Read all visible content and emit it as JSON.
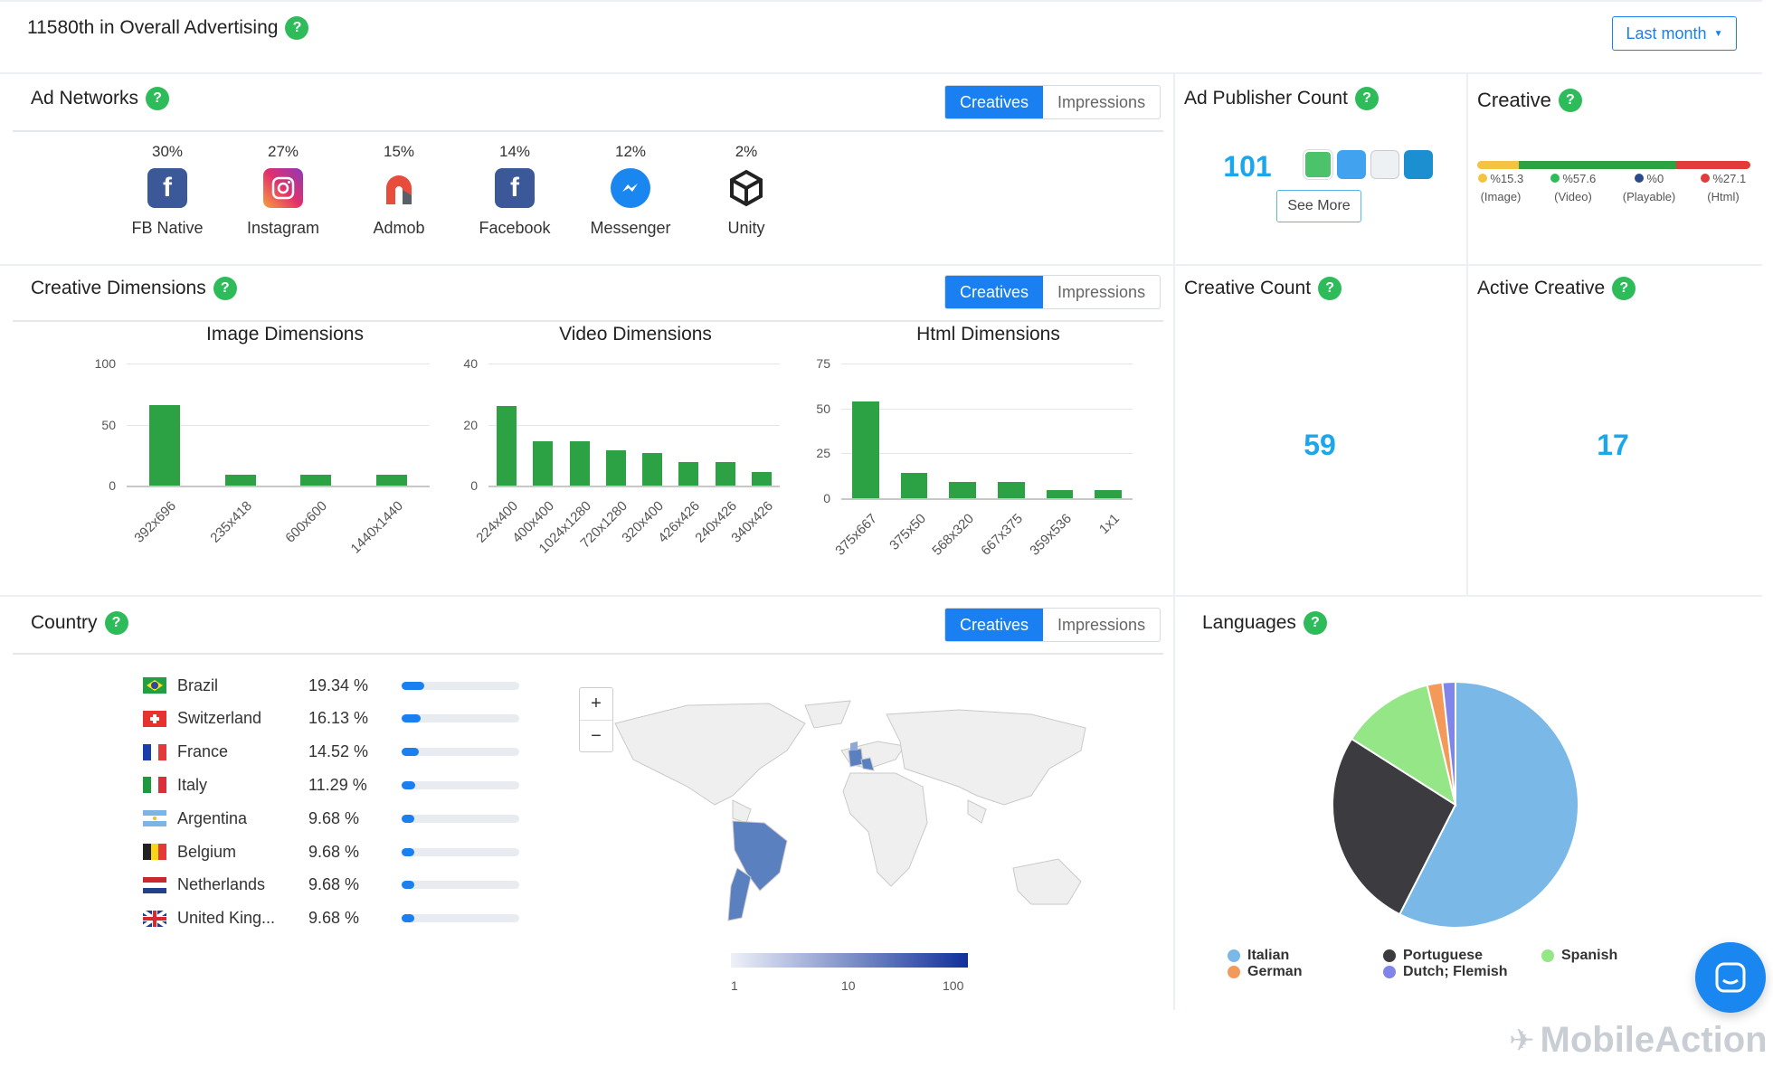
{
  "header": {
    "rank_title": "11580th in Overall Advertising",
    "period_button": "Last month",
    "help": "?"
  },
  "toggle": {
    "creatives": "Creatives",
    "impressions": "Impressions"
  },
  "ad_networks": {
    "title": "Ad Networks",
    "items": [
      {
        "name": "FB Native",
        "pct": "30%",
        "icon": "facebook-icon",
        "color": "#3b5998"
      },
      {
        "name": "Instagram",
        "pct": "27%",
        "icon": "instagram-icon",
        "color": "#e1306c"
      },
      {
        "name": "Admob",
        "pct": "15%",
        "icon": "admob-icon",
        "color": "#e84c3d"
      },
      {
        "name": "Facebook",
        "pct": "14%",
        "icon": "facebook-icon",
        "color": "#3b5998"
      },
      {
        "name": "Messenger",
        "pct": "12%",
        "icon": "messenger-icon",
        "color": "#1a86f0"
      },
      {
        "name": "Unity",
        "pct": "2%",
        "icon": "unity-icon",
        "color": "#222222"
      }
    ]
  },
  "ad_publisher": {
    "title": "Ad Publisher Count",
    "value": "101",
    "see_more": "See More"
  },
  "creative": {
    "title": "Creative",
    "segments": [
      {
        "pct": "%15.3",
        "label": "(Image)",
        "value": 15.3,
        "color": "#f5c342"
      },
      {
        "pct": "%57.6",
        "label": "(Video)",
        "value": 57.6,
        "color": "#2ca244"
      },
      {
        "pct": "%0",
        "label": "(Playable)",
        "value": 0,
        "color": "#2b4a8a"
      },
      {
        "pct": "%27.1",
        "label": "(Html)",
        "value": 27.1,
        "color": "#e03c3c"
      }
    ]
  },
  "creative_dimensions": {
    "title": "Creative Dimensions"
  },
  "creative_count": {
    "title": "Creative Count",
    "value": "59"
  },
  "active_creative": {
    "title": "Active Creative",
    "value": "17"
  },
  "chart_data": [
    {
      "type": "bar",
      "title": "Image Dimensions",
      "categories": [
        "392x696",
        "235x418",
        "600x600",
        "1440x1440"
      ],
      "values": [
        66,
        9,
        9,
        9
      ],
      "ylim": [
        0,
        100
      ],
      "yticks": [
        "100",
        "50",
        "0"
      ]
    },
    {
      "type": "bar",
      "title": "Video Dimensions",
      "categories": [
        "224x400",
        "400x400",
        "1024x1280",
        "720x1280",
        "320x400",
        "426x426",
        "240x426",
        "340x426"
      ],
      "values": [
        26,
        14.5,
        14.5,
        11.5,
        10.8,
        7.8,
        7.8,
        4.5
      ],
      "ylim": [
        0,
        40
      ],
      "yticks": [
        "40",
        "20",
        "0"
      ]
    },
    {
      "type": "bar",
      "title": "Html Dimensions",
      "categories": [
        "375x667",
        "375x50",
        "568x320",
        "667x375",
        "359x536",
        "1x1"
      ],
      "values": [
        54,
        14,
        9,
        9,
        4.5,
        4.5
      ],
      "ylim": [
        0,
        75
      ],
      "yticks": [
        "75",
        "50",
        "25",
        "0"
      ]
    },
    {
      "type": "pie",
      "title": "Languages",
      "series": [
        {
          "name": "Italian",
          "value": 57.5,
          "color": "#7ab8e8"
        },
        {
          "name": "Portuguese",
          "value": 26.5,
          "color": "#3c3c40"
        },
        {
          "name": "Spanish",
          "value": 12.3,
          "color": "#94e687"
        },
        {
          "name": "German",
          "value": 2.0,
          "color": "#f39a5a"
        },
        {
          "name": "Dutch; Flemish",
          "value": 1.7,
          "color": "#8085e9"
        }
      ]
    }
  ],
  "country": {
    "title": "Country",
    "rows": [
      {
        "name": "Brazil",
        "pct": "19.34 %",
        "value": 19.34,
        "flag": "brazil-flag"
      },
      {
        "name": "Switzerland",
        "pct": "16.13 %",
        "value": 16.13,
        "flag": "switzerland-flag"
      },
      {
        "name": "France",
        "pct": "14.52 %",
        "value": 14.52,
        "flag": "france-flag"
      },
      {
        "name": "Italy",
        "pct": "11.29 %",
        "value": 11.29,
        "flag": "italy-flag"
      },
      {
        "name": "Argentina",
        "pct": "9.68 %",
        "value": 9.68,
        "flag": "argentina-flag"
      },
      {
        "name": "Belgium",
        "pct": "9.68 %",
        "value": 9.68,
        "flag": "belgium-flag"
      },
      {
        "name": "Netherlands",
        "pct": "9.68 %",
        "value": 9.68,
        "flag": "netherlands-flag"
      },
      {
        "name": "United King...",
        "pct": "9.68 %",
        "value": 9.68,
        "flag": "uk-flag"
      }
    ],
    "map": {
      "zoom_in": "+",
      "zoom_out": "−",
      "scale": [
        "1",
        "10",
        "100"
      ]
    }
  },
  "languages": {
    "title": "Languages"
  },
  "brand": {
    "watermark": "MobileAction"
  }
}
